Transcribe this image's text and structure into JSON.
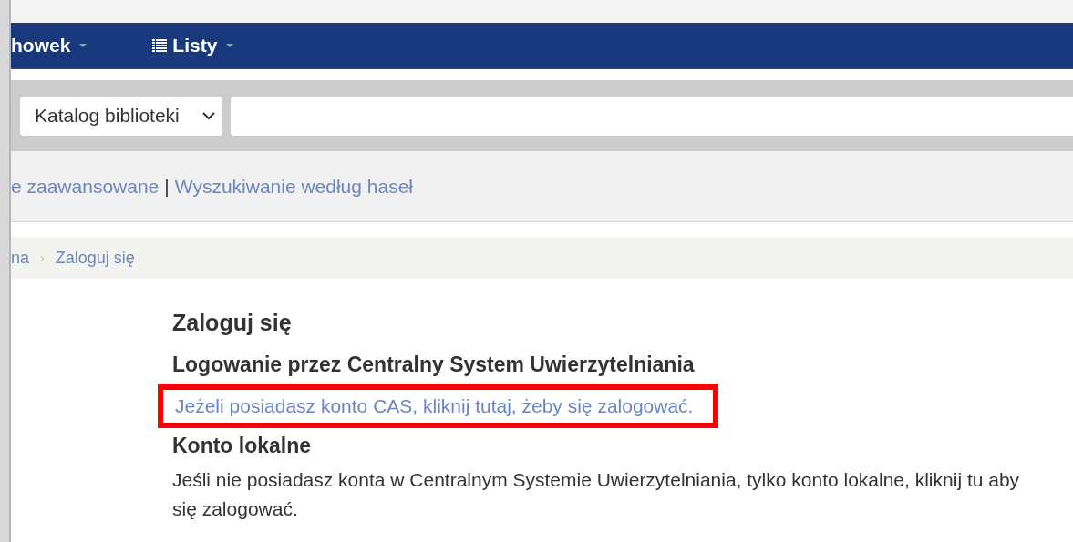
{
  "navbar": {
    "items": [
      {
        "label": "howek",
        "kind": "text"
      },
      {
        "label": "Listy",
        "kind": "list"
      }
    ]
  },
  "search": {
    "scope": "Katalog biblioteki"
  },
  "search_links": [
    {
      "label": "e zaawansowane"
    },
    {
      "label": "Wyszukiwanie według haseł",
      "separator": "|"
    }
  ],
  "breadcrumb": [
    {
      "label": "na"
    },
    {
      "label": "Zaloguj się",
      "separator": "›"
    }
  ],
  "login": {
    "title": "Zaloguj się",
    "sections": [
      {
        "heading": "Logowanie przez Centralny System Uwierzytelniania",
        "link": "Jeżeli posiadasz konto CAS, kliknij tutaj, żeby się zalogować.",
        "highlighted": true
      },
      {
        "heading": "Konto lokalne",
        "text": "Jeśli nie posiadasz konta w Centralnym Systemie Uwierzytelniania, tylko konto lokalne, kliknij tu aby się zalogować.",
        "highlighted": false
      }
    ]
  }
}
